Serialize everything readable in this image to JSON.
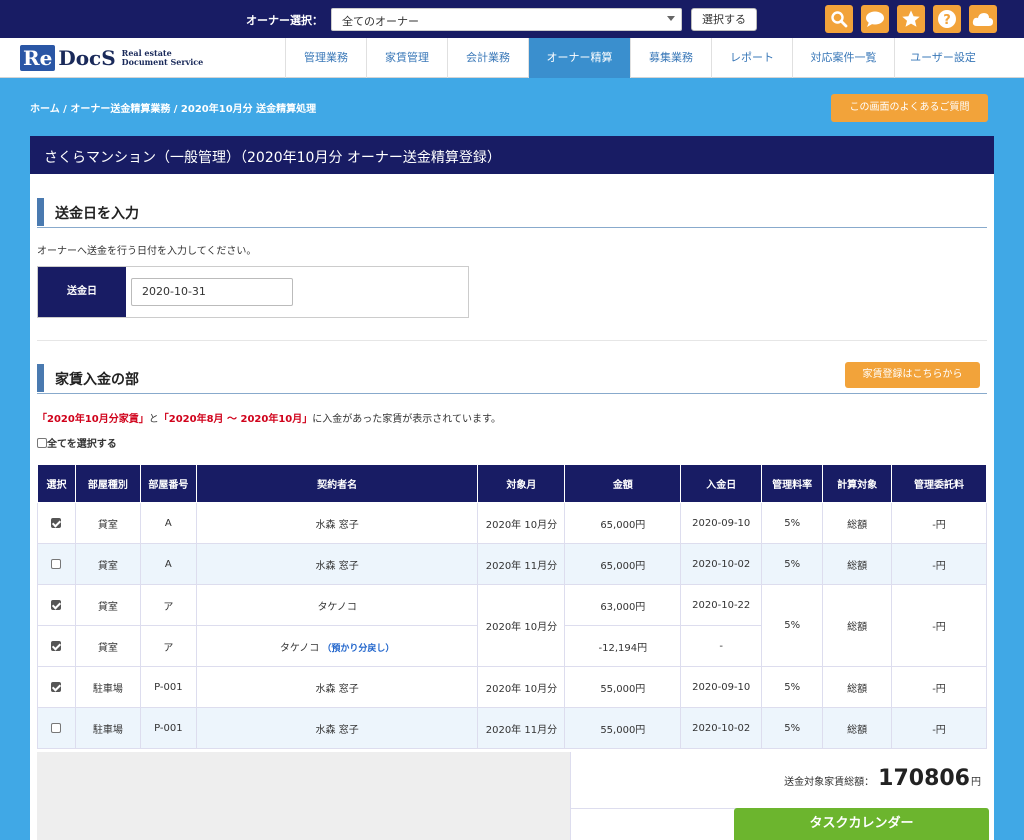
{
  "topbar": {
    "owner_label": "オーナー選択：",
    "owner_value": "全てのオーナー",
    "select_button": "選択する",
    "icons": [
      "search-icon",
      "chat-icon",
      "star-icon",
      "help-icon",
      "cloud-icon"
    ],
    "icon_color": "#f2a33a"
  },
  "logo": {
    "re": "Re",
    "docs": "DocS",
    "sub1": "Real estate",
    "sub2": "Document Service"
  },
  "nav": {
    "items": [
      "管理業務",
      "家賃管理",
      "会計業務",
      "オーナー精算",
      "募集業務",
      "レポート",
      "対応案件一覧",
      "ユーザー設定"
    ],
    "active": "オーナー精算"
  },
  "breadcrumb": "ホーム / オーナー送金精算業務 / 2020年10月分 送金精算処理",
  "faq_button": "この画面のよくあるご質問",
  "panel_title": "さくらマンション（一般管理）（2020年10月分 オーナー送金精算登録）",
  "section1": {
    "title": "送金日を入力",
    "description": "オーナーへ送金を行う日付を入力してください。",
    "date_label": "送金日",
    "date_value": "2020-10-31"
  },
  "section2": {
    "title": "家賃入金の部",
    "register_button": "家賃登録はこちらから",
    "desc_part1": "「2020年10月分家賃」",
    "desc_part2": "と",
    "desc_part3": "「2020年8月 ～ 2020年10月」",
    "desc_part4": "に入金があった家賃が表示されています。",
    "select_all": "全てを選択する"
  },
  "table": {
    "headers": [
      "選択",
      "部屋種別",
      "部屋番号",
      "契約者名",
      "対象月",
      "金額",
      "入金日",
      "管理料率",
      "計算対象",
      "管理委託料"
    ],
    "rows": [
      {
        "checked": true,
        "type": "貸室",
        "room": "A",
        "name": "水森 窓子",
        "month": "2020年 10月分",
        "amount": "65,000円",
        "paid": "2020-09-10",
        "rate": "5%",
        "calc": "総額",
        "fee": "-円"
      },
      {
        "checked": false,
        "type": "貸室",
        "room": "A",
        "name": "水森 窓子",
        "month": "2020年 11月分",
        "amount": "65,000円",
        "paid": "2020-10-02",
        "rate": "5%",
        "calc": "総額",
        "fee": "-円"
      },
      {
        "checked": true,
        "type": "貸室",
        "room": "ア",
        "name": "タケノコ",
        "month": "2020年 10月分",
        "amount": "63,000円",
        "paid": "2020-10-22",
        "rate": "5%",
        "calc": "総額",
        "fee": "-円"
      },
      {
        "checked": true,
        "type": "貸室",
        "room": "ア",
        "name": "タケノコ",
        "note": "（預かり分戻し）",
        "amount": "-12,194円",
        "paid": "-"
      },
      {
        "checked": true,
        "type": "駐車場",
        "room": "P-001",
        "name": "水森 窓子",
        "month": "2020年 10月分",
        "amount": "55,000円",
        "paid": "2020-09-10",
        "rate": "5%",
        "calc": "総額",
        "fee": "-円"
      },
      {
        "checked": false,
        "type": "駐車場",
        "room": "P-001",
        "name": "水森 窓子",
        "month": "2020年 11月分",
        "amount": "55,000円",
        "paid": "2020-10-02",
        "rate": "5%",
        "calc": "総額",
        "fee": "-円"
      }
    ]
  },
  "summary": {
    "label": "送金対象家賃総額：",
    "value": "170806",
    "unit": "円"
  },
  "task_button": "タスクカレンダー"
}
